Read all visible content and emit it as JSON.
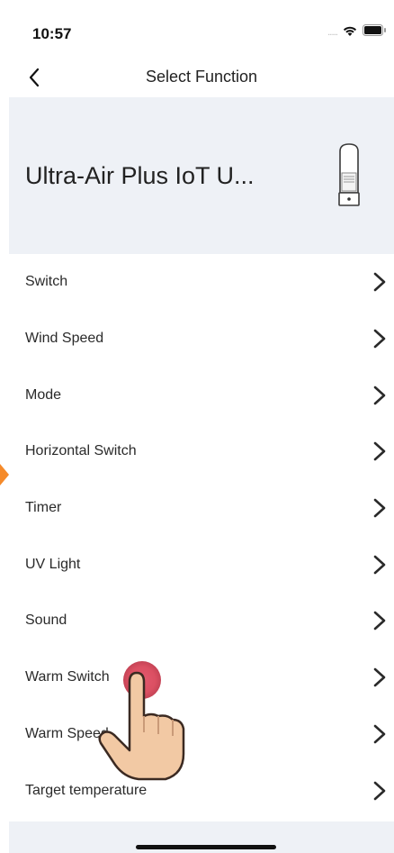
{
  "status_bar": {
    "time": "10:57",
    "signal": ".....",
    "icons": [
      "wifi-icon",
      "battery-icon"
    ]
  },
  "nav": {
    "title": "Select Function",
    "back_icon": "chevron-left-icon"
  },
  "device": {
    "name": "Ultra-Air Plus IoT U...",
    "image_icon": "air-purifier-icon"
  },
  "functions": [
    {
      "label": "Switch"
    },
    {
      "label": "Wind Speed"
    },
    {
      "label": "Mode"
    },
    {
      "label": "Horizontal Switch"
    },
    {
      "label": "Timer"
    },
    {
      "label": "UV Light"
    },
    {
      "label": "Sound"
    },
    {
      "label": "Warm Switch"
    },
    {
      "label": "Warm Speed"
    },
    {
      "label": "Target temperature"
    }
  ],
  "overlay": {
    "pointer_icon": "hand-pointer-icon",
    "marker_color": "#f58a2a",
    "tap_color": "#d9465a"
  },
  "colors": {
    "header_bg": "#eef1f6",
    "text": "#2a2a2a"
  }
}
